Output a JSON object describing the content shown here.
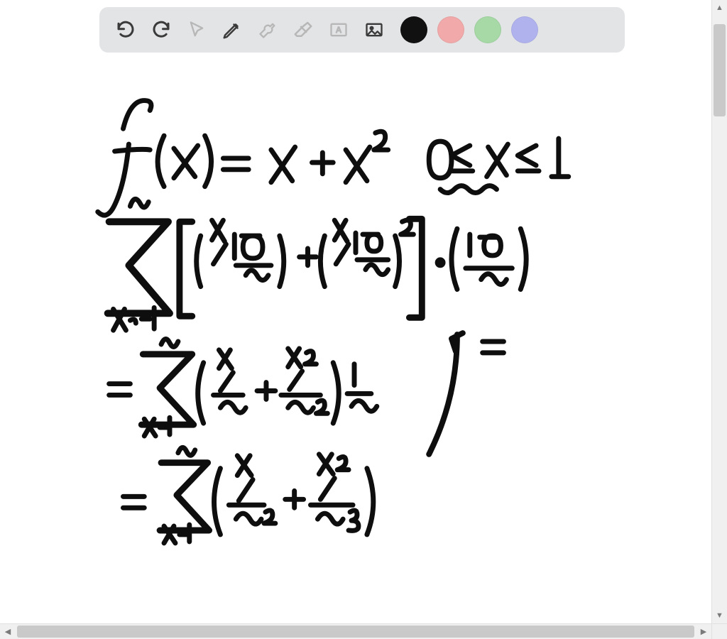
{
  "toolbar": {
    "undo_label": "Undo",
    "redo_label": "Redo",
    "pointer_label": "Select",
    "pen_label": "Pen",
    "tools_label": "Tools",
    "eraser_label": "Eraser",
    "textbox_label": "Text",
    "image_label": "Insert image",
    "colors": {
      "black": "#111111",
      "pink": "#f1a9a9",
      "green": "#a6d9a6",
      "purple": "#b0b2ee"
    }
  },
  "icons": {
    "undo": "undo-icon",
    "redo": "redo-icon",
    "pointer": "cursor-icon",
    "pen": "pen-icon",
    "tools": "wrench-icon",
    "eraser": "eraser-icon",
    "text": "text-box-icon",
    "image": "image-icon"
  },
  "scrollbar": {
    "up": "▲",
    "down": "▼",
    "left": "◀",
    "right": "▶"
  },
  "handwriting": {
    "line1": "f(x) = x + x^2",
    "line1_right": "0 ≤ x ≤ 1",
    "line2": "Σ_{k=1}^{n} [ (k·(1−0)/n) + (k·(1−0)/n)^2 ] · ((1−0)/n)",
    "line3": "= Σ_{k=1}^{n} ( k/n + k^2/n^2 ) · 1/n",
    "line4": "= Σ_{k=1}^{n} ( k/n^2 + k^2/n^3 )",
    "arrow_note": "→ ="
  }
}
